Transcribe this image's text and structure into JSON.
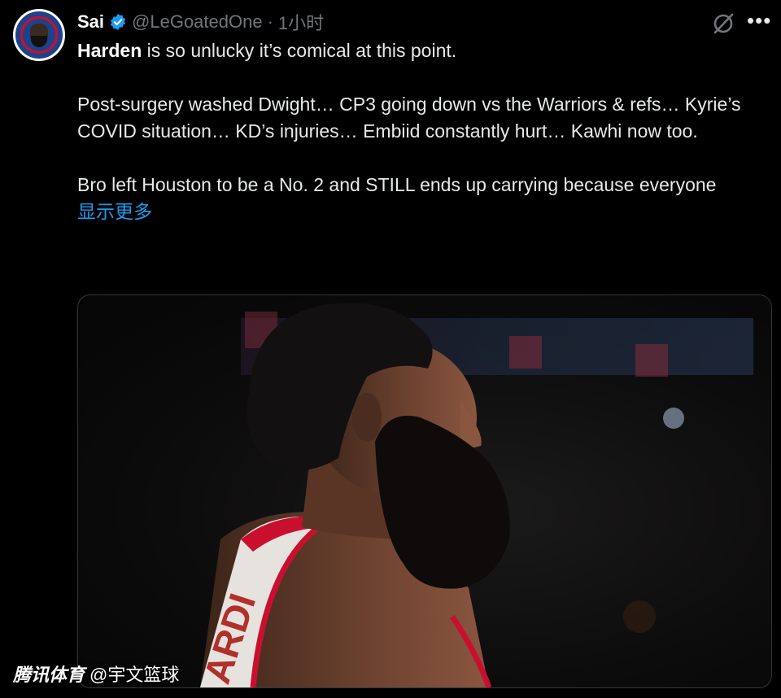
{
  "author": {
    "name": "Sai",
    "handle": "@LeGoatedOne",
    "separator": "·",
    "time": "1小时",
    "avatar_text": "LOS ANGELES CLIPPERS"
  },
  "tweet": {
    "bold_word": "Harden",
    "line1_rest": " is so unlucky it’s comical at this point.",
    "paragraph2": "Post-surgery washed Dwight… CP3 going down vs the Warriors & refs… Kyrie’s COVID situation… KD’s injuries… Embiid constantly hurt… Kawhi now too.",
    "paragraph3": "Bro left Houston to be a No. 2 and STILL ends up carrying because everyone",
    "show_more": "显示更多"
  },
  "media": {
    "jersey_text": "ARDI"
  },
  "icons": {
    "verified": "verified-badge-icon",
    "grok": "grok-icon",
    "more": "more-options-icon"
  },
  "colors": {
    "background": "#000000",
    "text": "#e7e9ea",
    "muted": "#71767b",
    "link": "#1d9bf0"
  },
  "watermark": {
    "brand": "腾讯体育",
    "author": "@宇文篮球"
  }
}
